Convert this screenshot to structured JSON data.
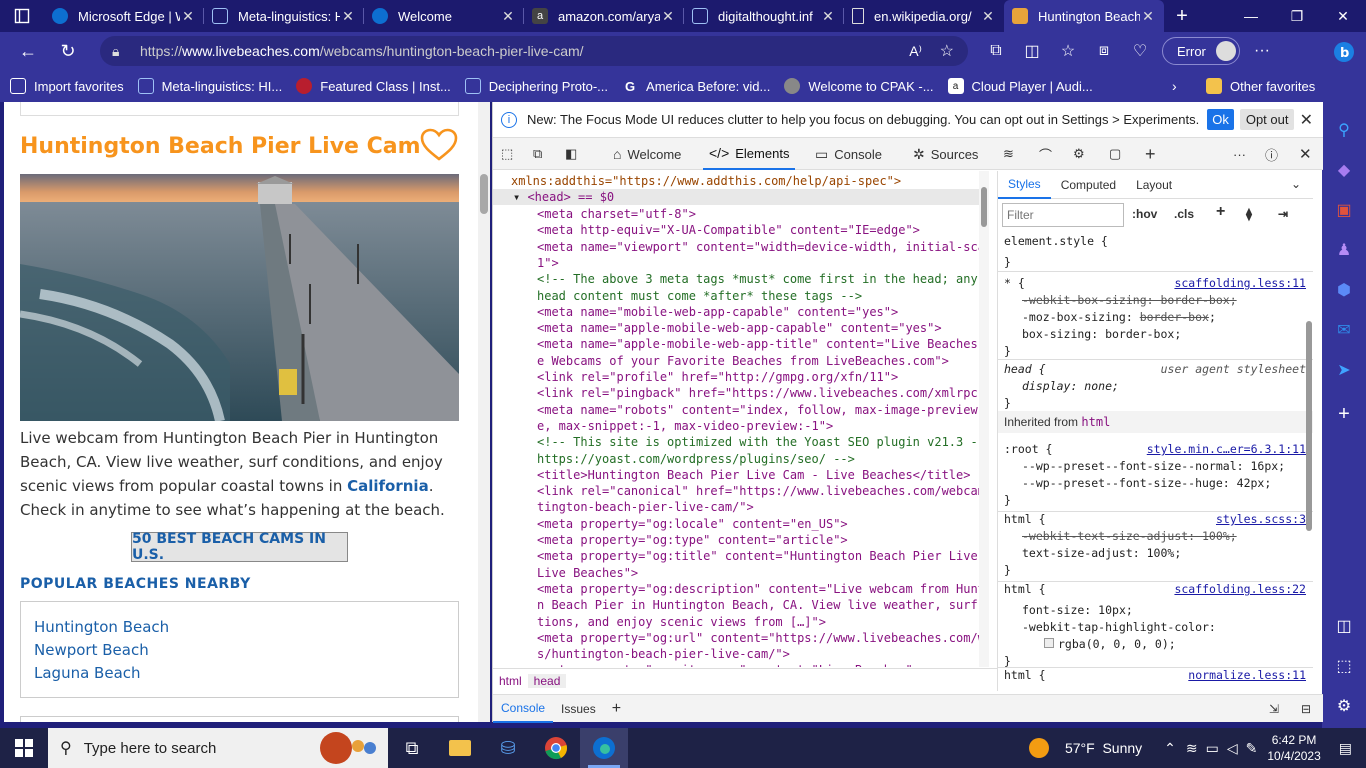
{
  "browser": {
    "tabs": [
      {
        "title": "Microsoft Edge | W",
        "color": "#0d6fd1"
      },
      {
        "title": "Meta-linguistics: H",
        "color": "#2e6ecf"
      },
      {
        "title": "Welcome",
        "color": "#0d6fd1"
      },
      {
        "title": "amazon.com/arya",
        "color": "#444444"
      },
      {
        "title": "digitalthought.inf",
        "color": "#2e6ecf"
      },
      {
        "title": "en.wikipedia.org/",
        "color": "#dddddd"
      },
      {
        "title": "Huntington Beach",
        "color": "#e8a33b"
      }
    ],
    "url_prefix": "https://",
    "url_domain": "www.livebeaches.com",
    "url_path": "/webcams/huntington-beach-pier-live-cam/",
    "profile_label": "Error",
    "favorites": [
      {
        "label": "Import favorites",
        "icon": "import-icon"
      },
      {
        "label": "Meta-linguistics: HI...",
        "icon": "grid-icon"
      },
      {
        "label": "Featured Class | Inst...",
        "icon": "shield-icon"
      },
      {
        "label": "Deciphering Proto-...",
        "icon": "grid-icon"
      },
      {
        "label": "America Before: vid...",
        "icon": "google-icon"
      },
      {
        "label": "Welcome to CPAK -...",
        "icon": "globe-icon"
      },
      {
        "label": "Cloud Player | Audi...",
        "icon": "amazon-icon"
      }
    ],
    "other_favorites": "Other favorites"
  },
  "webpage": {
    "title": "Huntington Beach Pier Live Cam",
    "description_before": "Live webcam from Huntington Beach Pier in Huntington Beach, CA. View live weather, surf conditions, and enjoy scenic views from popular coastal towns in ",
    "description_link": "California",
    "description_after": ". Check in anytime to see what’s happening at the beach.",
    "best_button": "50 BEST BEACH CAMS IN U.S.",
    "nearby_heading": "POPULAR BEACHES NEARBY",
    "nearby": [
      "Huntington Beach",
      "Newport Beach",
      "Laguna Beach"
    ],
    "accent": "#f7941d",
    "link_color": "#1a5fa8"
  },
  "devtools": {
    "banner": "New: The Focus Mode UI reduces clutter to help you focus on debugging. You can opt out in Settings > Experiments.",
    "ok": "Ok",
    "opt_out": "Opt out",
    "tabs": [
      "Welcome",
      "Elements",
      "Console",
      "Sources"
    ],
    "breadcrumbs": [
      "html",
      "head"
    ],
    "styles_tabs": [
      "Styles",
      "Computed",
      "Layout"
    ],
    "filter_placeholder": "Filter",
    "hov": ":hov",
    "cls": ".cls",
    "drawer": [
      "Console",
      "Issues"
    ],
    "elements_lines": [
      "xmlns:addthis=\"https://www.addthis.com/help/api-spec\">",
      "<head> == $0",
      "<meta charset=\"utf-8\">",
      "<meta http-equiv=\"X-UA-Compatible\" content=\"IE=edge\">",
      "<meta name=\"viewport\" content=\"width=device-width, initial-scale=",
      "1\">",
      "<!-- The above 3 meta tags *must* come first in the head; any other",
      "head content must come *after* these tags -->",
      "<meta name=\"mobile-web-app-capable\" content=\"yes\">",
      "<meta name=\"apple-mobile-web-app-capable\" content=\"yes\">",
      "<meta name=\"apple-mobile-web-app-title\" content=\"Live Beaches - Liv",
      "e Webcams of your Favorite Beaches from LiveBeaches.com\">",
      "<link rel=\"profile\" href=\"http://gmpg.org/xfn/11\">",
      "<link rel=\"pingback\" href=\"https://www.livebeaches.com/xmlrpc.php\">",
      "<meta name=\"robots\" content=\"index, follow, max-image-preview:larg",
      "e, max-snippet:-1, max-video-preview:-1\">",
      "<!-- This site is optimized with the Yoast SEO plugin v21.3 -",
      "https://yoast.com/wordpress/plugins/seo/ -->",
      "<title>Huntington Beach Pier Live Cam - Live Beaches</title>",
      "<link rel=\"canonical\" href=\"https://www.livebeaches.com/webcams/hun",
      "tington-beach-pier-live-cam/\">",
      "<meta property=\"og:locale\" content=\"en_US\">",
      "<meta property=\"og:type\" content=\"article\">",
      "<meta property=\"og:title\" content=\"Huntington Beach Pier Live Cam -",
      "Live Beaches\">",
      "<meta property=\"og:description\" content=\"Live webcam from Huntingto",
      "n Beach Pier in Huntington Beach, CA. View live weather, surf condi",
      "tions, and enjoy scenic views from […]\">",
      "<meta property=\"og:url\" content=\"https://www.livebeaches.com/webcam",
      "s/huntington-beach-pier-live-cam/\">",
      "<meta property=\"og:site_name\" content=\"Live Beaches\">"
    ],
    "styles": {
      "element_style": "element.style {",
      "r1_sel": "* {",
      "r1_src": "scaffolding.less:11",
      "r1_p1": "-webkit-box-sizing: border-box;",
      "r1_p2n": "-moz-box-sizing: ",
      "r1_p2v": "border-box",
      "r1_p3": "box-sizing: border-box;",
      "r2_sel": "head {",
      "r2_src": "user agent stylesheet",
      "r2_p1": "display: none;",
      "inherited_label": "Inherited from",
      "inherited_el": "html",
      "r3_sel": ":root {",
      "r3_src": "style.min.c…er=6.3.1:11",
      "r3_p1n": "--wp--preset--font-size--normal: ",
      "r3_p1v": "16px;",
      "r3_p2n": "--wp--preset--font-size--huge: ",
      "r3_p2v": "42px;",
      "r4_sel": "html {",
      "r4_src": "styles.scss:3",
      "r4_p1": "-webkit-text-size-adjust: 100%;",
      "r4_p2": "text-size-adjust: 100%;",
      "r5_sel": "html {",
      "r5_src": "scaffolding.less:22",
      "r5_p1n": "font-size: ",
      "r5_p1v": "10px;",
      "r5_p2": "-webkit-tap-highlight-color:",
      "r5_p3": "rgba(0, 0, 0, 0);",
      "r6_sel": "html {",
      "r6_src": "normalize.less:11",
      "close_brace": "}"
    }
  },
  "taskbar": {
    "search_placeholder": "Type here to search",
    "weather": "57°F  Sunny",
    "time": "6:42 PM",
    "date": "10/4/2023"
  }
}
